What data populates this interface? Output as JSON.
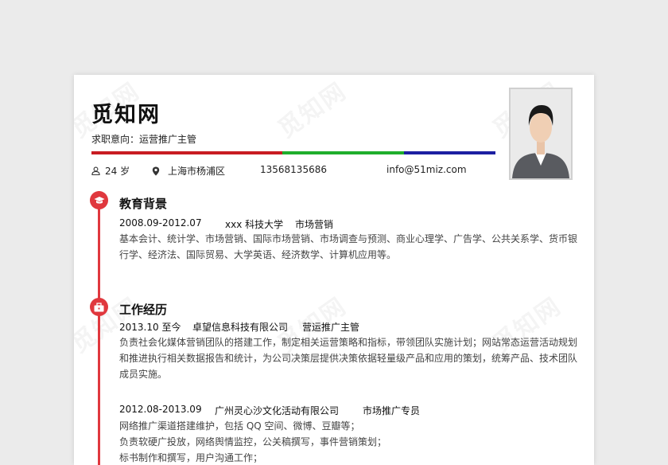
{
  "colors": {
    "accent": "#e0383e",
    "bar_red": "#c81c22",
    "bar_green": "#1fae2c",
    "bar_blue": "#1c1fa1"
  },
  "watermark": "觅知网",
  "header": {
    "name": "觅知网",
    "job_intent": "求职意向：运营推广主管",
    "age": "24 岁",
    "location": "上海市杨浦区",
    "phone": "13568135686",
    "email": "info@51miz.com"
  },
  "icons": {
    "age": "user-icon",
    "location": "location-pin-icon",
    "education": "graduation-cap-icon",
    "work": "briefcase-icon"
  },
  "education": {
    "title": "教育背景",
    "period": "2008.09-2012.07",
    "school": "xxx 科技大学",
    "major": "市场营销",
    "desc": "基本会计、统计学、市场营销、国际市场营销、市场调查与预测、商业心理学、广告学、公共关系学、货币银行学、经济法、国际贸易、大学英语、经济数学、计算机应用等。"
  },
  "work": {
    "title": "工作经历",
    "jobs": [
      {
        "period": "2013.10 至今",
        "company": "卓望信息科技有限公司",
        "position": "营运推广主管",
        "desc": "负责社会化媒体营销团队的搭建工作，制定相关运营策略和指标，带领团队实施计划；网站常态运营活动规划和推进执行相关数据报告和统计，为公司决策层提供决策依据轻量级产品和应用的策划，统筹产品、技术团队成员实施。"
      },
      {
        "period": "2012.08-2013.09",
        "company": "广州灵心沙文化活动有限公司",
        "position": "市场推广专员",
        "lines": [
          "网络推广渠道搭建维护，包括 QQ 空间、微博、豆瓣等；",
          "负责软硬广投放，网络舆情监控，公关稿撰写，事件营销策划；",
          "标书制作和撰写，用户沟通工作；"
        ]
      }
    ]
  }
}
